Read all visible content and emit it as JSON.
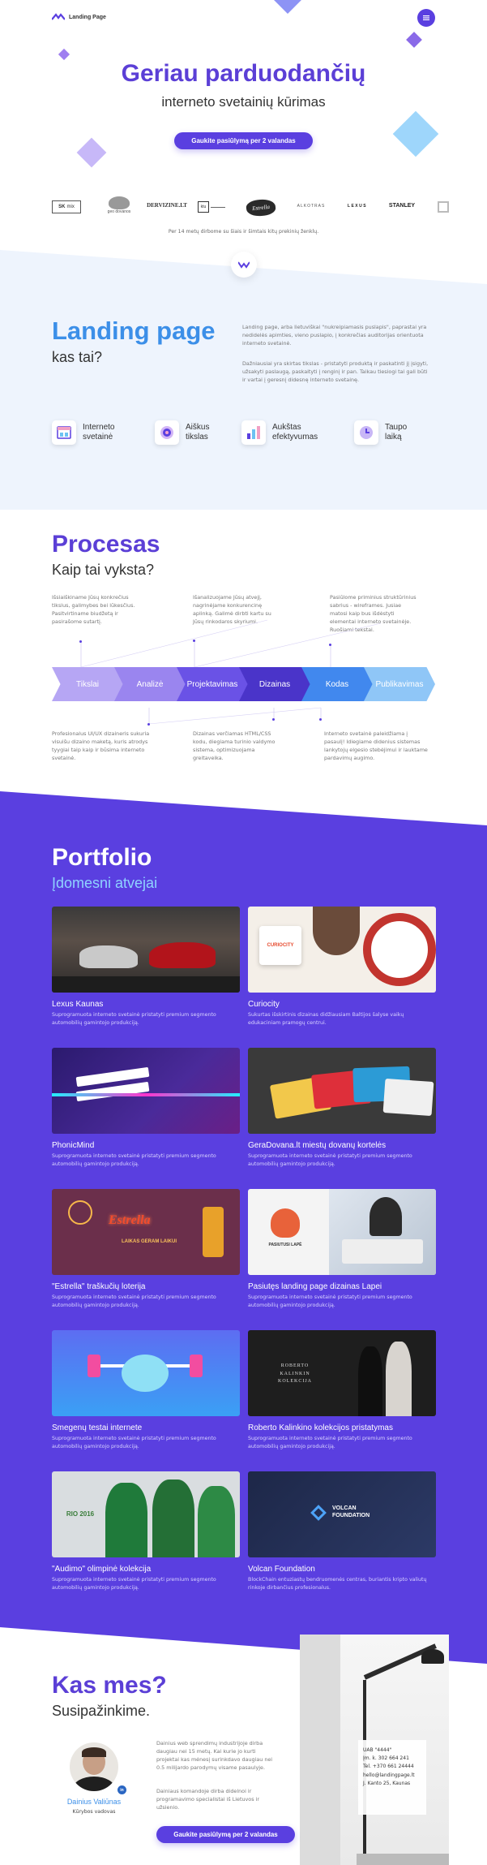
{
  "nav": {
    "brand": "Landing Page"
  },
  "hero": {
    "title": "Geriau parduodančių",
    "subtitle": "interneto svetainių kūrimas",
    "cta": "Gaukite pasiūlymą per 2 valandas"
  },
  "clients": {
    "logos": [
      "",
      "geo dovanos",
      "DERVIZINE.LT",
      "",
      "Estrella",
      "ALKOTRAS",
      "LEXUS",
      "STANLEY"
    ],
    "caption": "Per 14 metų dirbome su šiais ir šimtais kitų prekinių ženklų."
  },
  "about": {
    "title": "Landing page",
    "subtitle": "kas tai?",
    "p1": "Landing page, arba lietuviškai \"nukreipiamasis puslapis\", paprastai yra nedidelės apimties, vieno puslapio, į konkrečias auditorijas orientuota interneto svetainė.",
    "p2": "Dažniausiai yra skirtas tikslas - pristatyti produktą ir paskatinti jį įsigyti, užsakyti paslaugą, paskaityti į renginį ir pan. Taikau tiesiogi tai gali būti ir vartai į geresnį didesnę interneto svetainę.",
    "features": [
      {
        "label": "Interneto svetainė",
        "icon": "browser-icon"
      },
      {
        "label": "Aiškus tikslas",
        "icon": "target-icon"
      },
      {
        "label": "Aukštas efektyvumas",
        "icon": "bar-chart-icon"
      },
      {
        "label": "Taupo laiką",
        "icon": "clock-icon"
      }
    ]
  },
  "process": {
    "title": "Procesas",
    "subtitle": "Kaip tai vyksta?",
    "top_texts": [
      "Išsiaiškiname Jūsų konkrečius tikslus, galimybes bei lūkesčius. Pasitvirtiname biudžetą ir pasirašome sutartį.",
      "Išanalizuojame Jūsų atvejį, nagrinėjame konkurencinę aplinką. Galimė dirbti kartu su Jūsų rinkodaros skyriumi.",
      "Pasiūlome priminius struktūrinius sabrius - wireframes. Jusiae matosi kaip bus išdėstyti elementai interneto svetainėje. Ruošiami tekstai."
    ],
    "steps": [
      "Tikslai",
      "Analizė",
      "Projektavimas",
      "Dizainas",
      "Kodas",
      "Publikavimas"
    ],
    "step_colors": [
      "#b6a6f4",
      "#9a85ef",
      "#6a52e6",
      "#4a34c9",
      "#4188ee",
      "#8fc6f7"
    ],
    "bottom_texts": [
      "Profesionalus UI/UX dizaineris sukuria visuišu dizaino maketą, kuris atrodys tyygiai taip kaip ir būsima interneto svetainė.",
      "Dizainas verčiamas HTML/CSS kodu, diegiama turinio valdymo sistema, optimizuojama greitaveika.",
      "Interneto svetainė paleidžiama į pasaulį! Idiegiame didenius sistemas lankytojų elgesio stebėjimui ir lauktame pardavimų augimo."
    ]
  },
  "portfolio": {
    "title": "Portfolio",
    "subtitle": "Įdomesni atvejai",
    "items": [
      {
        "title": "Lexus Kaunas",
        "desc": "Suprogramuota interneto svetainė pristatyti premium segmento automobilių gamintojo produkciją."
      },
      {
        "title": "Curiocity",
        "desc": "Sukurtas išskirtinis dizainas didžiausiam Baltijos šalyse vaikų edukaciniam pramogų centrui."
      },
      {
        "title": "PhonicMind",
        "desc": "Suprogramuota interneto svetainė pristatyti premium segmento automobilių gamintojo produkciją."
      },
      {
        "title": "GeraDovana.lt miestų dovanų kortelės",
        "desc": "Suprogramuota interneto svetainė pristatyti premium segmento automobilių gamintojo produkciją."
      },
      {
        "title": "\"Estrella\" traškučių loterija",
        "desc": "Suprogramuota interneto svetainė pristatyti premium segmento automobilių gamintojo produkciją."
      },
      {
        "title": "Pasiutęs landing page dizainas Lapei",
        "desc": "Suprogramuota interneto svetainė pristatyti premium segmento automobilių gamintojo produkciją."
      },
      {
        "title": "Smegenų testai internete",
        "desc": "Suprogramuota interneto svetainė pristatyti premium segmento automobilių gamintojo produkciją."
      },
      {
        "title": "Roberto Kalinkino kolekcijos pristatymas",
        "desc": "Suprogramuota interneto svetainė pristatyti premium segmento automobilių gamintojo produkciją."
      },
      {
        "title": "\"Audimo\" olimpinė kolekcija",
        "desc": "Suprogramuota interneto svetainė pristatyti premium segmento automobilių gamintojo produkciją."
      },
      {
        "title": "Volcan Foundation",
        "desc": "BlockChain entuziastų bendruomenės centras, buriantis kripto valiutų rinkoje dirbančius profesionalus."
      }
    ],
    "image_texts": {
      "curiocity": "CURIOCITY",
      "estrella": "Estrella",
      "laikas": "LAIKAS GERAM LAIKUI",
      "pasiutes": "PASIUTUSI LAPĖ",
      "roberto": "ROBERTO KALINKIN KOLEKCIJA",
      "rio": "RIO 2016",
      "volcan1": "VOLCAN",
      "volcan2": "FOUNDATION"
    }
  },
  "team": {
    "title": "Kas mes?",
    "subtitle": "Susipažinkime.",
    "name": "Dainius Valiūnas",
    "role": "Kūrybos vadovas",
    "p1": "Dainius web sprendimų industrijoje dirba daugiau nei 15 metų. Kai kurie jo kurti projektai kas mėnesį surinkdavo daugiau nei 0.5 milijardo parodymų visame pasaulyje.",
    "p2": "Dainiaus komandoje dirba didelnoi ir programavimo specialistai iš Lietuvos ir užsienio.",
    "cta": "Gaukite pasiūlymą per 2 valandas",
    "company": [
      "UAB \"4444\"",
      "Įm. k. 302 664 241",
      "Tel. +370 661 24444",
      "hello@landingpage.lt",
      "J. Kanto 25, Kaunas"
    ]
  },
  "colors": {
    "primary": "#5a3fe0",
    "title": "#5b3fd6",
    "about_blue": "#3c8fe8",
    "about_bg": "#eef4fd",
    "portfolio_bg": "#5a3fe0"
  }
}
